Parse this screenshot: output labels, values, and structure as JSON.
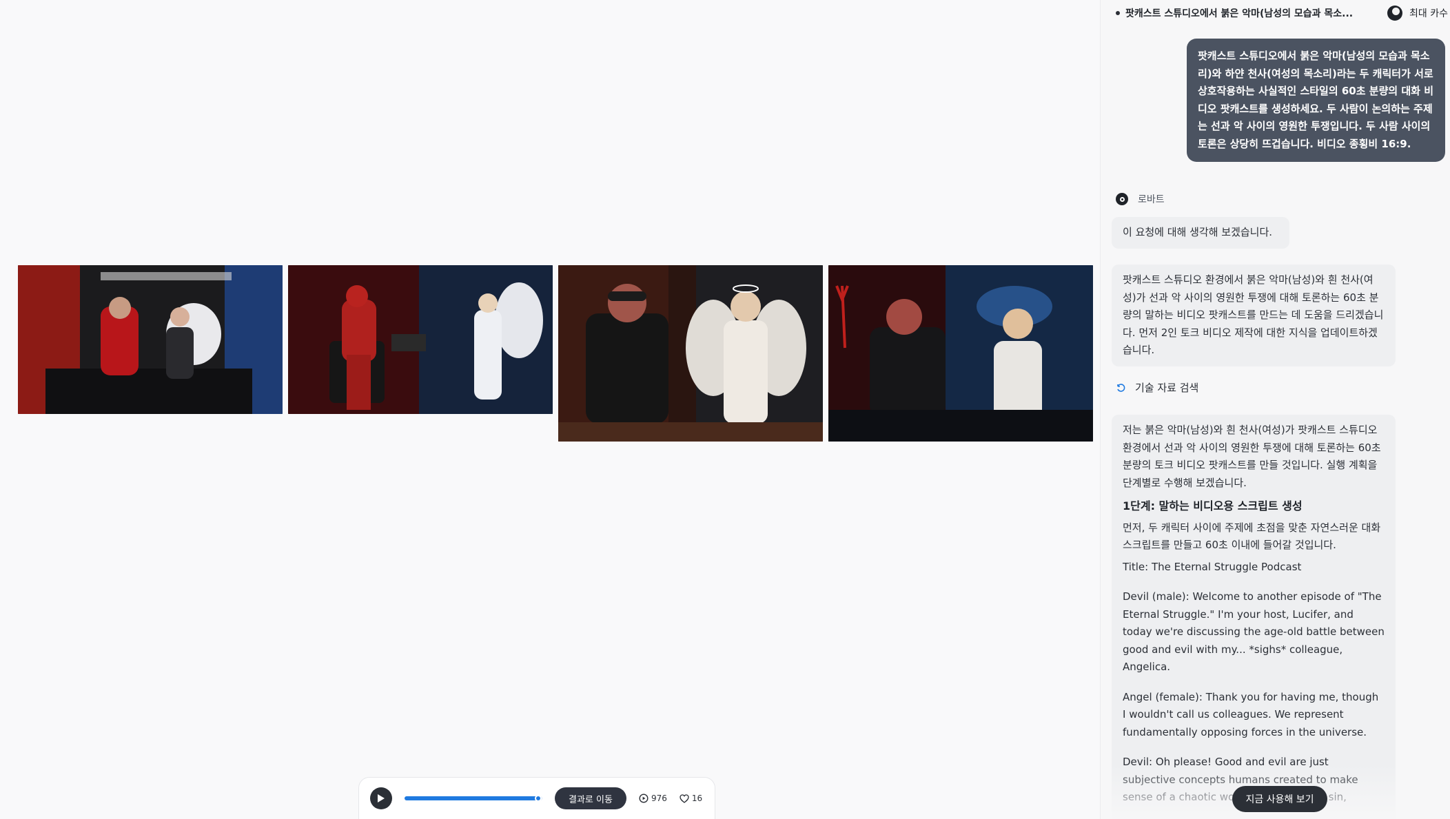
{
  "header": {
    "title": "팟캐스트 스튜디오에서 붉은 악마(남성의 모습과 목소...",
    "user_name": "최대 카수"
  },
  "gallery": {
    "images": [
      {
        "icon": "podcast-scene-image-1"
      },
      {
        "icon": "podcast-scene-image-2"
      },
      {
        "icon": "podcast-scene-image-3"
      },
      {
        "icon": "podcast-scene-image-4"
      }
    ]
  },
  "player": {
    "goto_label": "결과로 이동",
    "views": "976",
    "likes": "16",
    "progress": 0.97
  },
  "chat": {
    "user_message": "팟캐스트 스튜디오에서 붉은 악마(남성의 모습과 목소리)와 하얀 천사(여성의 목소리)라는 두 캐릭터가 서로 상호작용하는 사실적인 스타일의 60초 분량의 대화 비디오 팟캐스트를 생성하세요. 두 사람이 논의하는 주제는 선과 악 사이의 영원한 투쟁입니다. 두 사람 사이의 토론은 상당히 뜨겁습니다. 비디오 종횡비 16:9.",
    "bot_name": "로바트",
    "msg_thinking": "이 요청에 대해 생각해 보겠습니다.",
    "msg_intro": "팟캐스트 스튜디오 환경에서 붉은 악마(남성)와 흰 천사(여성)가 선과 악 사이의 영원한 투쟁에 대해 토론하는 60초 분량의 말하는 비디오 팟캐스트를 만드는 데 도움을 드리겠습니다. 먼저 2인 토크 비디오 제작에 대한 지식을 업데이트하겠습니다.",
    "search_label": "기술 자료 검색",
    "plan_text": "저는 붉은 악마(남성)와 흰 천사(여성)가 팟캐스트 스튜디오 환경에서 선과 악 사이의 영원한 투쟁에 대해 토론하는 60초 분량의 토크 비디오 팟캐스트를 만들 것입니다. 실행 계획을 단계별로 수행해 보겠습니다.",
    "step1_title": "1단계: 말하는 비디오용 스크립트 생성",
    "step1_text": "먼저, 두 캐릭터 사이에 주제에 초점을 맞춘 자연스러운 대화 스크립트를 만들고 60초 이내에 들어갈 것입니다.",
    "script_title": "Title: The Eternal Struggle Podcast",
    "line1": "Devil (male): Welcome to another episode of \"The Eternal Struggle.\" I'm your host, Lucifer, and today we're discussing the age-old battle between good and evil with my... *sighs* colleague, Angelica.",
    "line2": "Angel (female): Thank you for having me, though I wouldn't call us colleagues. We represent fundamentally opposing forces in the universe.",
    "line3": "Devil: Oh please! Good and evil are just subjective concepts humans created to make sense of a chaotic world. What you call sin,"
  },
  "cta": {
    "label": "지금 사용해 보기"
  },
  "colors": {
    "accent": "#1f7ae0",
    "dark_button": "#2f3440",
    "user_bubble": "#4b5361"
  }
}
